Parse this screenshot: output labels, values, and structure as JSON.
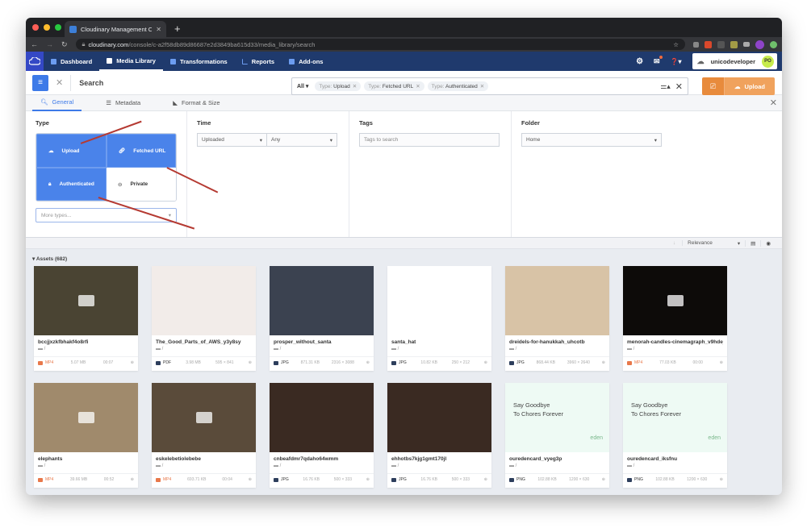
{
  "browser": {
    "tab_title": "Cloudinary Management Console",
    "url_domain": "cloudinary.com",
    "url_path": "/console/c-a2f58db89d86687e2d3849ba615d33/media_library/search"
  },
  "appnav": {
    "items": [
      {
        "label": "Dashboard",
        "icon": "dashboard-icon"
      },
      {
        "label": "Media Library",
        "icon": "media-library-icon",
        "active": true
      },
      {
        "label": "Transformations",
        "icon": "transformations-icon"
      },
      {
        "label": "Reports",
        "icon": "reports-icon"
      },
      {
        "label": "Add-ons",
        "icon": "addons-icon"
      }
    ],
    "username": "unicodeveloper",
    "avatar_initials": "PO"
  },
  "search": {
    "title": "Search",
    "scope": "All",
    "chips": [
      {
        "key": "Type:",
        "value": "Upload"
      },
      {
        "key": "Type:",
        "value": "Fetched URL"
      },
      {
        "key": "Type:",
        "value": "Authenticated"
      }
    ],
    "upload_label": "Upload"
  },
  "filter_tabs": [
    {
      "label": "General",
      "active": true
    },
    {
      "label": "Metadata"
    },
    {
      "label": "Format & Size"
    }
  ],
  "filters": {
    "type_heading": "Type",
    "types": [
      {
        "label": "Upload",
        "selected": true
      },
      {
        "label": "Fetched URL",
        "selected": true
      },
      {
        "label": "Authenticated",
        "selected": true
      },
      {
        "label": "Private",
        "selected": false
      }
    ],
    "more_types_placeholder": "More types...",
    "time_heading": "Time",
    "time_field": "Uploaded",
    "time_range": "Any",
    "tags_heading": "Tags",
    "tags_placeholder": "Tags to search",
    "folder_heading": "Folder",
    "folder_value": "Home"
  },
  "results": {
    "sort": "Relevance",
    "assets_label": "Assets (682)",
    "assets": [
      {
        "name": "bccjjxzkfbhakf4o8rfi",
        "folder": "/",
        "format": "MP4",
        "size": "5.07 MB",
        "extra": "00:07",
        "video": true,
        "thumb": "#4a4433"
      },
      {
        "name": "The_Good_Parts_of_AWS_y3y8sy",
        "folder": "/",
        "format": "PDF",
        "size": "3.98 MB",
        "extra": "595 × 841",
        "video": false,
        "thumb": "#f2ece9"
      },
      {
        "name": "prosper_without_santa",
        "folder": "/",
        "format": "JPG",
        "size": "871.31 KB",
        "extra": "2316 × 3088",
        "video": false,
        "thumb": "#3b4250"
      },
      {
        "name": "santa_hat",
        "folder": "/",
        "format": "JPG",
        "size": "10.82 KB",
        "extra": "250 × 212",
        "video": false,
        "thumb": "#ffffff"
      },
      {
        "name": "dreidels-for-hanukkah_uhcotb",
        "folder": "/",
        "format": "JPG",
        "size": "868.44 KB",
        "extra": "3960 × 2640",
        "video": false,
        "thumb": "#d8c3a6"
      },
      {
        "name": "menorah-candles-cinemagraph_v9hdej",
        "folder": "/",
        "format": "MP4",
        "size": "77.03 KB",
        "extra": "00:00",
        "video": true,
        "thumb": "#0d0b09"
      },
      {
        "name": "elephants",
        "folder": "/",
        "format": "MP4",
        "size": "39.66 MB",
        "extra": "00:52",
        "video": true,
        "thumb": "#a08a6c"
      },
      {
        "name": "eskelebetiolebebe",
        "folder": "/",
        "format": "MP4",
        "size": "693.71 KB",
        "extra": "00:04",
        "video": true,
        "thumb": "#5a4b3a"
      },
      {
        "name": "cnbeafdmr7qdaho64wmm",
        "folder": "/",
        "format": "JPG",
        "size": "16.76 KB",
        "extra": "500 × 333",
        "video": false,
        "thumb": "#3a2a22"
      },
      {
        "name": "ehhotbs7kjg1gmt170jl",
        "folder": "/",
        "format": "JPG",
        "size": "16.76 KB",
        "extra": "500 × 333",
        "video": false,
        "thumb": "#3a2a22"
      },
      {
        "name": "ouredencard_vyeg3p",
        "folder": "/",
        "format": "PNG",
        "size": "102.88 KB",
        "extra": "1200 × 630",
        "video": false,
        "thumb": "#eefaf4",
        "card_text": [
          "Say Goodbye",
          "To Chores Forever"
        ],
        "brand": "eden"
      },
      {
        "name": "ouredencard_iksfnu",
        "folder": "/",
        "format": "PNG",
        "size": "102.88 KB",
        "extra": "1200 × 630",
        "video": false,
        "thumb": "#eefaf4",
        "card_text": [
          "Say Goodbye",
          "To Chores Forever"
        ],
        "brand": "eden"
      }
    ]
  }
}
